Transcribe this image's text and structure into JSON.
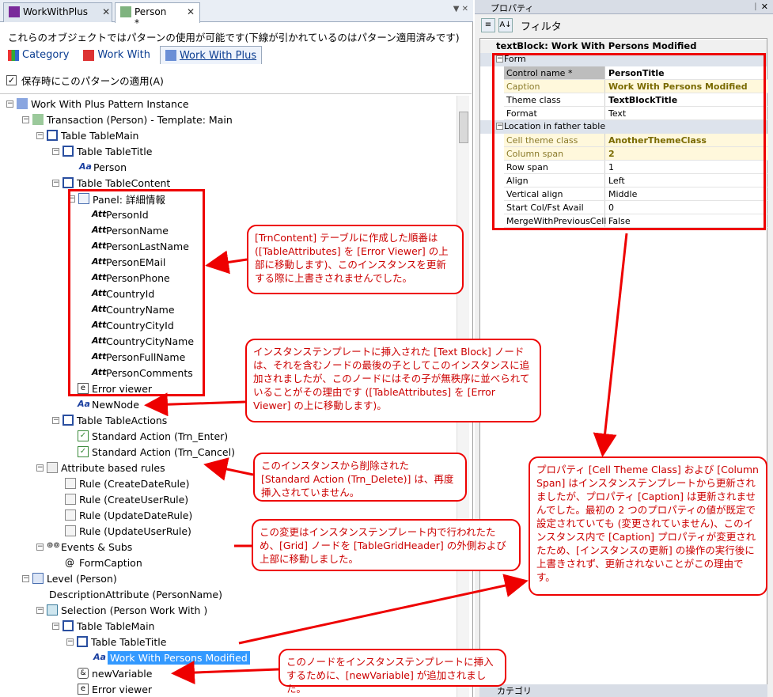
{
  "tabs": [
    {
      "label": "WorkWithPlus",
      "close": "✕"
    },
    {
      "label": "Person *",
      "close": "✕"
    }
  ],
  "description": "これらのオブジェクトではパターンの使用が可能です(下線が引かれているのはパターン適用済みです)",
  "subtabs": [
    "Category",
    "Work With",
    "Work With Plus"
  ],
  "apply_on_save": "保存時にこのパターンの適用(A)",
  "tree": {
    "root": "Work With Plus Pattern Instance",
    "transaction": "Transaction (Person) - Template: Main",
    "table_main": "Table TableMain",
    "table_title": "Table TableTitle",
    "person": "Person",
    "table_content": "Table TableContent",
    "panel": "Panel: 詳細情報",
    "attrs": [
      "PersonId",
      "PersonName",
      "PersonLastName",
      "PersonEMail",
      "PersonPhone",
      "CountryId",
      "CountryName",
      "CountryCityId",
      "CountryCityName",
      "PersonFullName",
      "PersonComments"
    ],
    "error_viewer": "Error viewer",
    "new_node": "NewNode",
    "table_actions": "Table TableActions",
    "action_enter": "Standard Action (Trn_Enter)",
    "action_cancel": "Standard Action (Trn_Cancel)",
    "attr_rules": "Attribute based rules",
    "rules": [
      "Rule (CreateDateRule)",
      "Rule (CreateUserRule)",
      "Rule (UpdateDateRule)",
      "Rule (UpdateUserRule)"
    ],
    "events": "Events & Subs",
    "form_caption": "FormCaption",
    "level": "Level (Person)",
    "desc_attr": "DescriptionAttribute (PersonName)",
    "selection": "Selection (Person Work With )",
    "table_main2": "Table TableMain",
    "table_title2": "Table TableTitle",
    "wwpm": "Work With Persons Modified",
    "new_variable": "newVariable",
    "error_viewer2": "Error viewer"
  },
  "properties": {
    "title": "プロパティ",
    "pin": "ᛁ ✕",
    "filter": "フィルタ",
    "header": "textBlock: Work With Persons Modified",
    "cat_form": "Form",
    "cat_location": "Location in father table",
    "rows_form": [
      {
        "k": "Control name *",
        "v": "PersonTitle"
      },
      {
        "k": "Caption",
        "v": "Work With Persons Modified"
      },
      {
        "k": "Theme class",
        "v": "TextBlockTitle"
      },
      {
        "k": "Format",
        "v": "Text"
      }
    ],
    "rows_location": [
      {
        "k": "Cell theme class",
        "v": "AnotherThemeClass"
      },
      {
        "k": "Column span",
        "v": "2"
      },
      {
        "k": "Row span",
        "v": "1"
      },
      {
        "k": "Align",
        "v": "Left"
      },
      {
        "k": "Vertical align",
        "v": "Middle"
      },
      {
        "k": "Start Col/Fst Avail",
        "v": "0"
      },
      {
        "k": "MergeWithPreviousCell",
        "v": "False"
      }
    ],
    "footer": "カテゴリ"
  },
  "callouts": {
    "c1": "[TrnContent] テーブルに作成した順番は ([TableAttributes] を [Error Viewer] の上部に移動します)、このインスタンスを更新する際に上書きされませんでした。",
    "c2": "インスタンステンプレートに挿入された [Text Block] ノードは、それを含むノードの最後の子としてこのインスタンスに追加されましたが、このノードにはその子が無秩序に並べられていることがその理由です ([TableAttributes] を [Error Viewer] の上に移動します)。",
    "c3": "このインスタンスから削除された [Standard Action (Trn_Delete)] は、再度挿入されていません。",
    "c4": "この変更はインスタンステンプレート内で行われたため、[Grid] ノードを [TableGridHeader] の外側および上部に移動しました。",
    "c5": "プロパティ [Cell Theme Class] および [Column Span] はインスタンステンプレートから更新されましたが、プロパティ [Caption] は更新されませんでした。最初の 2 つのプロパティの値が既定で設定されていても (変更されていません)、このインスタンス内で [Caption] プロパティが変更されたため、[インスタンスの更新] の操作の実行後に上書きされず、更新されないことがこの理由です。",
    "c6": "このノードをインスタンステンプレートに挿入するために、[newVariable] が追加されました。"
  }
}
